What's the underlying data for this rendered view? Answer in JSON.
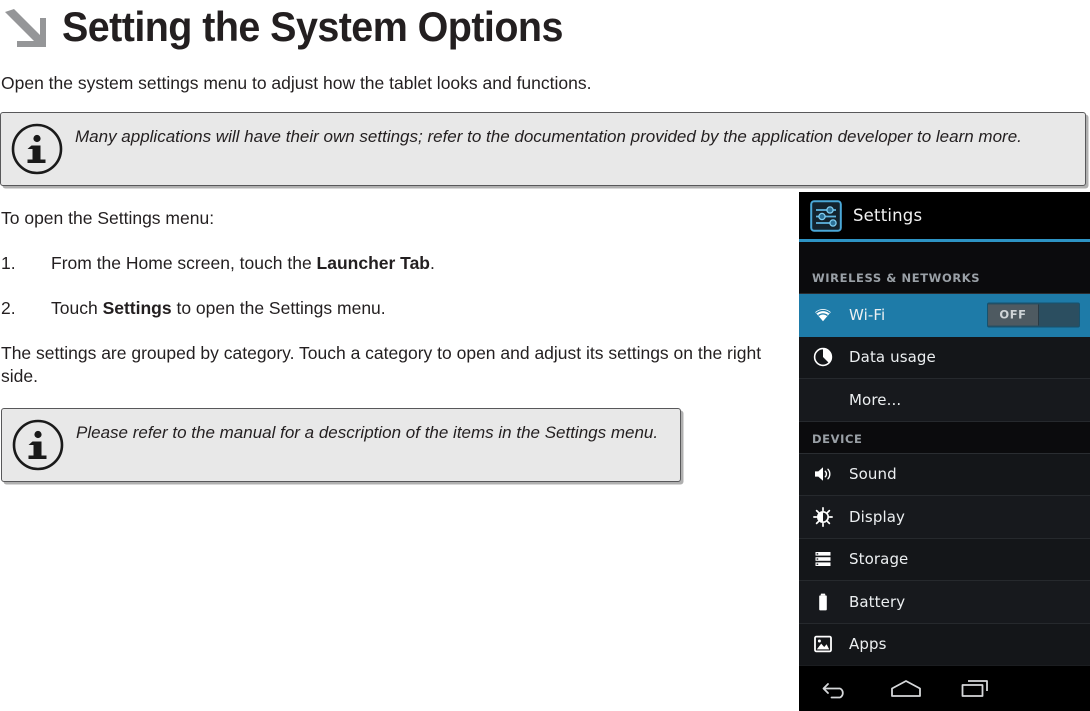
{
  "page": {
    "title": "Setting the System Options",
    "title_arrow_icon": "arrow-down-right-icon",
    "intro": "Open the system settings menu to adjust how the tablet looks and functions."
  },
  "notes": [
    {
      "icon": "info-icon",
      "text": "Many applications will have their own settings; refer to the documentation provided by the application developer to learn more."
    },
    {
      "icon": "info-icon",
      "text": "Please refer to the manual for a description of the items in the Settings menu."
    }
  ],
  "body": {
    "lead_in": "To open the Settings menu:",
    "steps": [
      {
        "number": "1.",
        "text_before": "From the Home screen, touch the ",
        "bold": "Launcher Tab",
        "text_after": "."
      },
      {
        "number": "2.",
        "text_before": "Touch ",
        "bold": "Settings",
        "text_after": " to open the Settings menu."
      }
    ],
    "closing": "The settings are grouped by category. Touch a category to open and adjust its settings on the right side."
  },
  "android": {
    "header": {
      "title": "Settings",
      "icon": "settings-sliders-icon"
    },
    "accent_color": "#2d93c4",
    "selected_color": "#1e7ba8",
    "sections": [
      {
        "label": "WIRELESS & NETWORKS",
        "rows": [
          {
            "label": "Wi-Fi",
            "icon": "wifi-icon",
            "selected": true,
            "toggle": "OFF"
          },
          {
            "label": "Data usage",
            "icon": "pie-chart-icon",
            "selected": false
          },
          {
            "label": "More...",
            "icon": "",
            "selected": false
          }
        ]
      },
      {
        "label": "DEVICE",
        "rows": [
          {
            "label": "Sound",
            "icon": "speaker-icon",
            "selected": false
          },
          {
            "label": "Display",
            "icon": "brightness-icon",
            "selected": false
          },
          {
            "label": "Storage",
            "icon": "storage-icon",
            "selected": false
          },
          {
            "label": "Battery",
            "icon": "battery-icon",
            "selected": false
          },
          {
            "label": "Apps",
            "icon": "apps-image-icon",
            "selected": false
          }
        ]
      }
    ],
    "navbar": {
      "back": "back-icon",
      "home": "home-icon",
      "recents": "recents-icon"
    }
  }
}
